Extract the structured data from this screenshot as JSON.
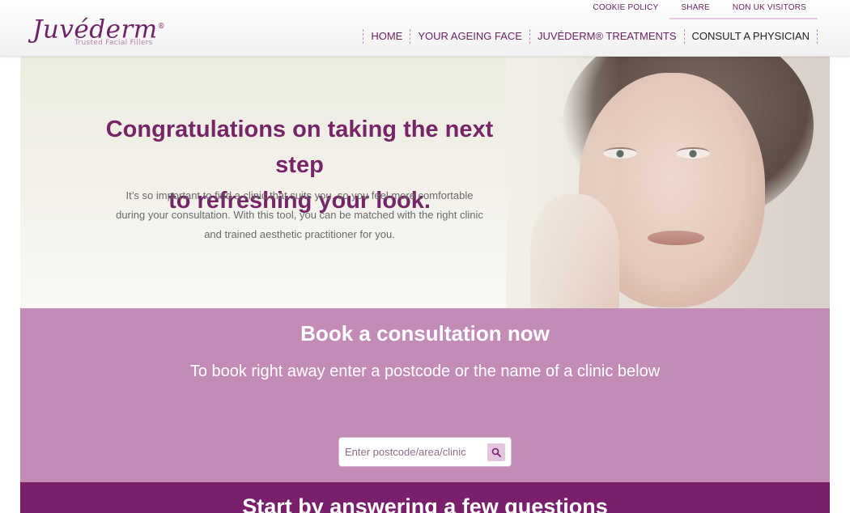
{
  "header": {
    "logo": {
      "name": "Juvéderm",
      "reg": "®",
      "tagline": "Trusted Facial Fillers"
    },
    "utility_nav": [
      "COOKIE POLICY",
      "SHARE",
      "NON UK VISITORS"
    ],
    "main_nav": [
      "HOME",
      "YOUR AGEING FACE",
      "JUVÉDERM® TREATMENTS",
      "CONSULT A PHYSICIAN"
    ]
  },
  "hero": {
    "title_line1": "Congratulations on taking the next step",
    "title_line2": "to refreshing your look.",
    "body_line1": "It’s so important to find a clinic that suits you, so you feel more comfortable",
    "body_line2": "during your consultation. With this tool, you can be matched with the right clinic",
    "body_line3": "and trained aesthetic practitioner for you."
  },
  "booking": {
    "title": "Book a consultation now",
    "subtitle": "To book right away enter a postcode or the name of a clinic below",
    "search_placeholder": "Enter postcode/area/clinic",
    "search_icon": "search-icon"
  },
  "questions": {
    "title": "Start by answering a few questions"
  },
  "colors": {
    "brand": "#7a1f6b",
    "booking_bg": "#c38cb6",
    "hero_title": "#762569"
  }
}
